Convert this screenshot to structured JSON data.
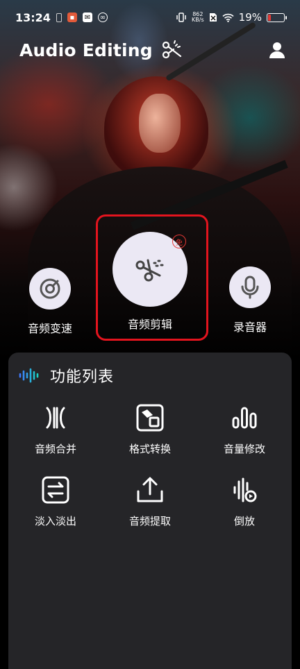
{
  "status_bar": {
    "time": "13:24",
    "net_speed_value": "862",
    "net_speed_unit": "KB/s",
    "battery_percent": "19%",
    "battery_level": 0.19,
    "battery_color": "#e53935"
  },
  "header": {
    "title": "Audio Editing",
    "title_icon": "scissors-icon",
    "profile_icon": "person-icon"
  },
  "main_actions": [
    {
      "label": "音频变速",
      "icon": "speed-dial-icon"
    },
    {
      "label": "音频剪辑",
      "icon": "scissors-icon",
      "badge": "免",
      "highlighted": true
    },
    {
      "label": "录音器",
      "icon": "microphone-icon"
    }
  ],
  "function_list": {
    "title": "功能列表",
    "icon": "waveform-icon",
    "items": [
      {
        "label": "音频合并",
        "icon": "merge-icon"
      },
      {
        "label": "格式转换",
        "icon": "format-convert-icon"
      },
      {
        "label": "音量修改",
        "icon": "volume-bars-icon"
      },
      {
        "label": "淡入淡出",
        "icon": "fade-arrows-icon"
      },
      {
        "label": "音频提取",
        "icon": "upload-icon"
      },
      {
        "label": "倒放",
        "icon": "reverse-play-icon"
      }
    ]
  },
  "colors": {
    "accent_red": "#e3141e",
    "circle_bg": "#ebe8f4",
    "panel_bg": "#252528",
    "wave_gradient": [
      "#3f7bff",
      "#19d3c5"
    ]
  }
}
